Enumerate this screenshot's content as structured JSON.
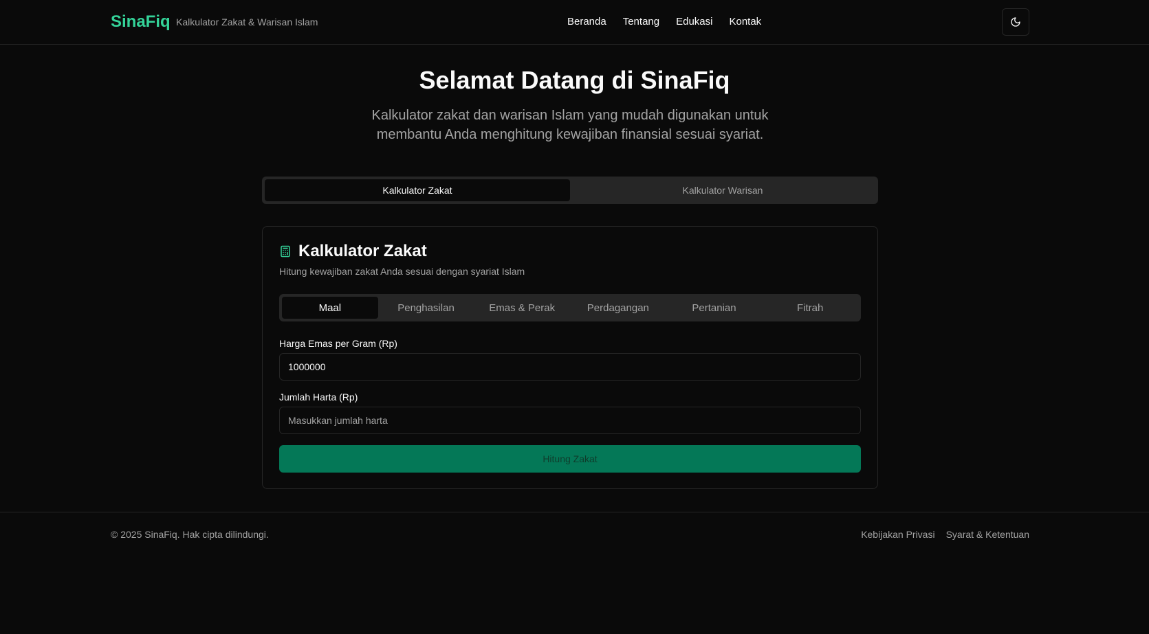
{
  "header": {
    "brand": "SinaFiq",
    "subtitle": "Kalkulator Zakat & Warisan Islam",
    "nav": [
      "Beranda",
      "Tentang",
      "Edukasi",
      "Kontak"
    ],
    "theme_icon": "moon-icon"
  },
  "hero": {
    "title": "Selamat Datang di SinaFiq",
    "subtitle": "Kalkulator zakat dan warisan Islam yang mudah digunakan untuk membantu Anda menghitung kewajiban finansial sesuai syariat."
  },
  "main_tabs": [
    "Kalkulator Zakat",
    "Kalkulator Warisan"
  ],
  "card": {
    "icon": "calculator-icon",
    "accent": "#34d399",
    "title": "Kalkulator Zakat",
    "description": "Hitung kewajiban zakat Anda sesuai dengan syariat Islam",
    "sub_tabs": [
      "Maal",
      "Penghasilan",
      "Emas & Perak",
      "Perdagangan",
      "Pertanian",
      "Fitrah"
    ],
    "gold_price_label": "Harga Emas per Gram (Rp)",
    "gold_price_value": "1000000",
    "assets_label": "Jumlah Harta (Rp)",
    "assets_placeholder": "Masukkan jumlah harta",
    "submit_label": "Hitung Zakat"
  },
  "footer": {
    "copyright": "© 2025 SinaFiq. Hak cipta dilindungi.",
    "links": [
      "Kebijakan Privasi",
      "Syarat & Ketentuan"
    ]
  }
}
